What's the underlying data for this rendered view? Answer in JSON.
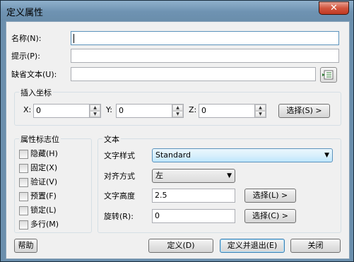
{
  "window": {
    "title": "定义属性",
    "close": "✕"
  },
  "attribute": {
    "name_label": "名称(N):",
    "name_value": "",
    "prompt_label": "提示(P):",
    "prompt_value": "",
    "default_label": "缺省文本(U):",
    "default_value": ""
  },
  "insert_point": {
    "title": "插入坐标",
    "x_label": "X:",
    "x_value": "0",
    "y_label": "Y:",
    "y_value": "0",
    "z_label": "Z:",
    "z_value": "0",
    "select_label": "选择(S) >"
  },
  "flags": {
    "title": "属性标志位",
    "items": [
      {
        "label": "隐藏(H)",
        "checked": false
      },
      {
        "label": "固定(X)",
        "checked": false
      },
      {
        "label": "验证(V)",
        "checked": false
      },
      {
        "label": "预置(F)",
        "checked": false
      },
      {
        "label": "锁定(L)",
        "checked": false
      },
      {
        "label": "多行(M)",
        "checked": false
      }
    ]
  },
  "text": {
    "title": "文本",
    "style_label": "文字样式",
    "style_value": "Standard",
    "align_label": "对齐方式",
    "align_value": "左",
    "height_label": "文字高度",
    "height_value": "2.5",
    "height_select": "选择(L) >",
    "rotation_label": "旋转(R):",
    "rotation_value": "0",
    "rotation_select": "选择(C) >"
  },
  "footer": {
    "help": "帮助",
    "define": "定义(D)",
    "define_exit": "定义并退出(E)",
    "close": "关闭"
  },
  "colors": {
    "title_bar": "#6f93b2",
    "close_button": "#c8452d",
    "dialog_bg": "#f0f0f0"
  }
}
